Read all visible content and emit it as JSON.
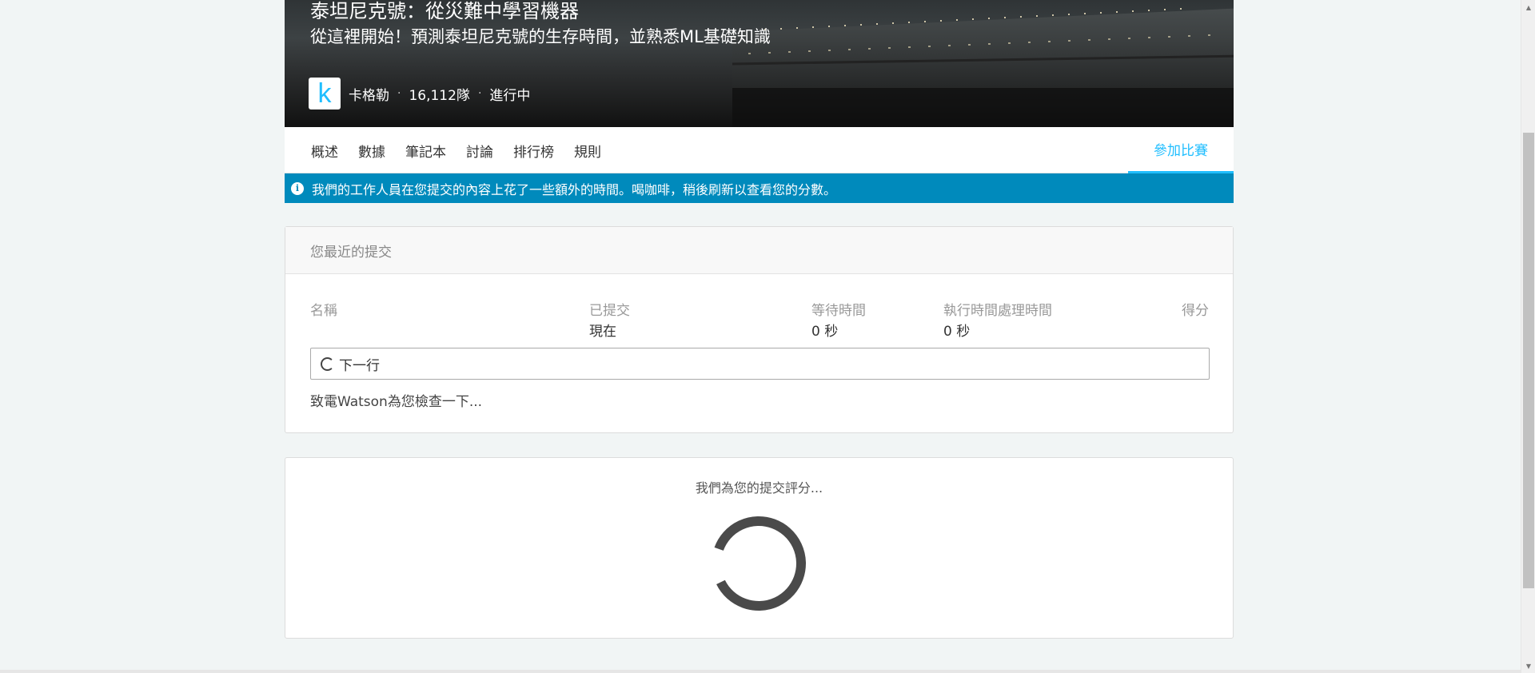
{
  "competition": {
    "title": "泰坦尼克號：從災難中學習機器",
    "subtitle": "從這裡開始！預測泰坦尼克號的生存時間，並熟悉ML基礎知識",
    "host_logo_letter": "k",
    "host": "卡格勒",
    "teams": "16,112隊",
    "status": "進行中",
    "separator": "·"
  },
  "tabs": [
    {
      "label": "概述"
    },
    {
      "label": "數據"
    },
    {
      "label": "筆記本"
    },
    {
      "label": "討論"
    },
    {
      "label": "排行榜"
    },
    {
      "label": "規則"
    }
  ],
  "join_button": "參加比賽",
  "info_banner": {
    "icon": "info-icon",
    "message": "我們的工作人員在您提交的內容上花了一些額外的時間。喝咖啡，稍後刷新以查看您的分數。"
  },
  "submissions": {
    "header": "您最近的提交",
    "columns": {
      "name": "名稱",
      "submitted": "已提交",
      "wait_time": "等待時間",
      "execution_time": "執行時間處理時間",
      "score": "得分"
    },
    "row": {
      "submitted": "現在",
      "wait_time": "0 秒",
      "execution_time": "0 秒"
    },
    "loading_label": "下一行",
    "watson_message": "致電Watson為您檢查一下..."
  },
  "grading": {
    "message": "我們為您的提交評分..."
  },
  "colors": {
    "accent": "#20beff",
    "info_bg": "#008abc"
  }
}
